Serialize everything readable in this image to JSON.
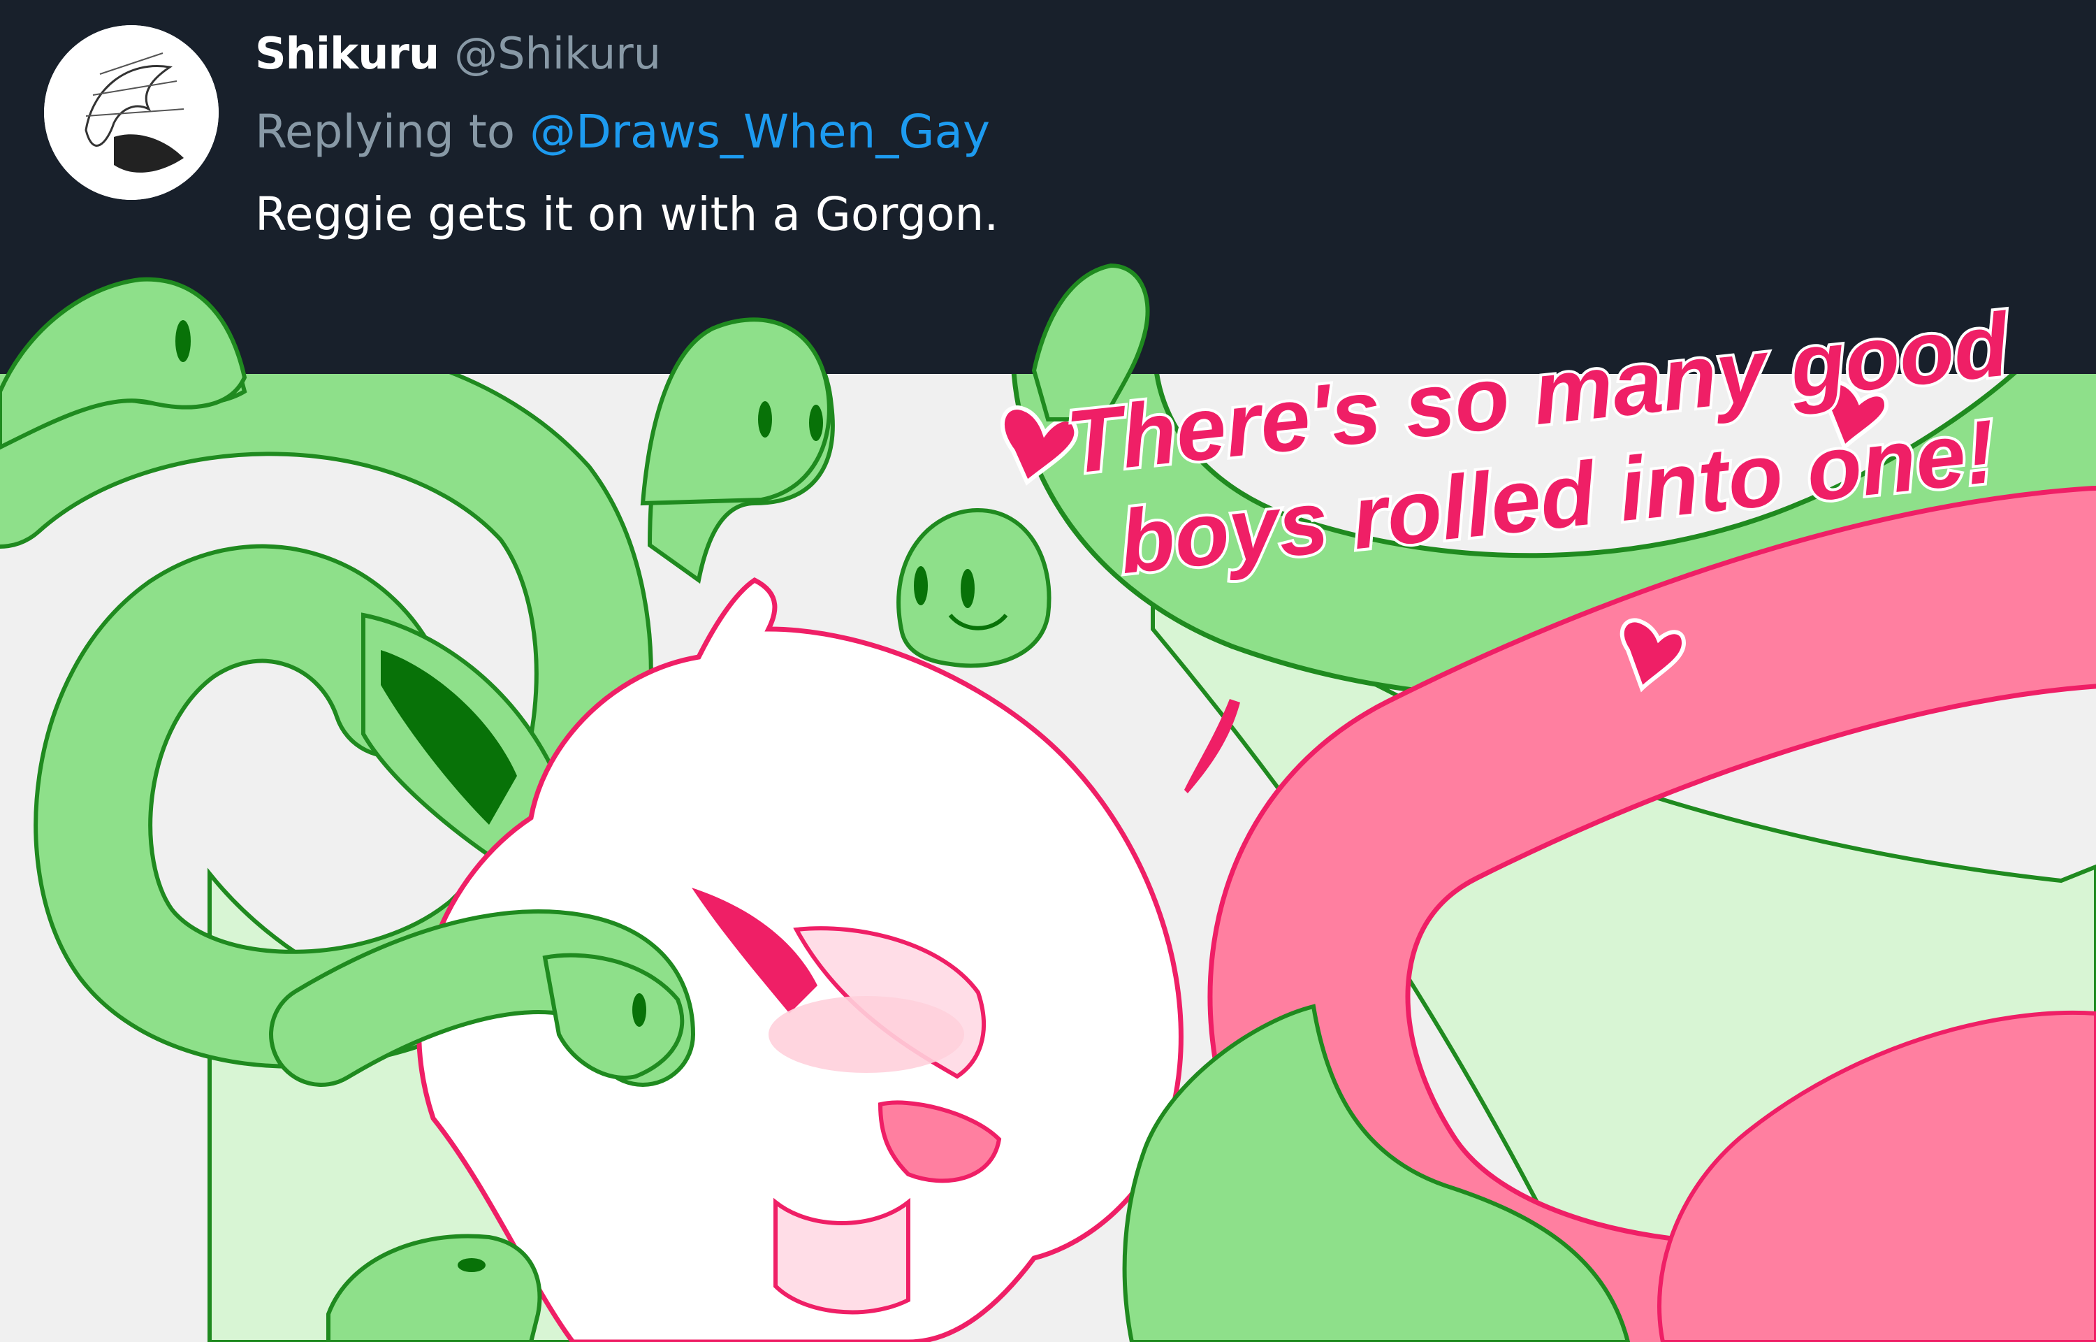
{
  "tweet": {
    "display_name": "Shikuru",
    "handle": "@Shikuru",
    "replying_prefix": "Replying to",
    "replying_to": "@Draws_When_Gay",
    "text": "Reggie gets it on with a Gorgon."
  },
  "artwork": {
    "speech_line_1": "There's so many good",
    "speech_line_2": "boys rolled into one!"
  },
  "colors": {
    "header_bg": "#18202b",
    "handle_gray": "#8899a6",
    "link_blue": "#1d9bf0",
    "snake_green": "#8ee08a",
    "snake_outline": "#1f8a1f",
    "tentacle_pink": "#ff7fa0",
    "speech_pink": "#ef1f66"
  }
}
